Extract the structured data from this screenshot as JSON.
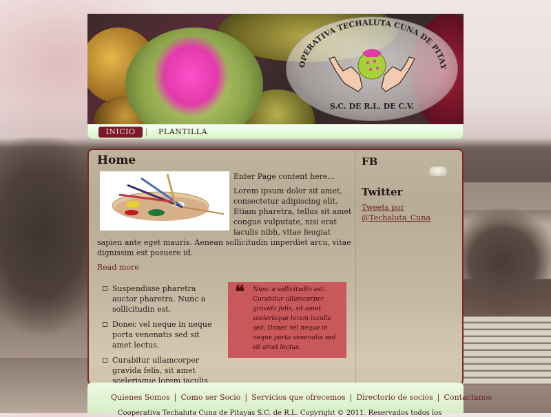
{
  "header": {
    "logo": {
      "arc_top": "COOPERATIVA TECHALUTA CUNA DE PITAYAS",
      "arc_bottom": "S.C. DE R.L. DE C.V."
    }
  },
  "nav": {
    "items": [
      {
        "label": "INICIO",
        "active": true
      },
      {
        "label": "PLANTILLA",
        "active": false
      }
    ]
  },
  "main": {
    "title": "Home",
    "intro": "Enter Page content here...",
    "body": "Lorem ipsum dolor sit amet, consectetur adipiscing elit. Etiam pharetra, tellus sit amet congue vulputate, nisi erat iaculis nibh, vitae feugiat sapien ante eget mauris. Aenean sollicitudin imperdiet arcu, vitae dignissim est posuere id.",
    "read_more": "Read more",
    "bullets": [
      "Suspendisse pharetra auctor pharetra. Nunc a sollicitudin est.",
      "Donec vel neque in neque porta venenatis sed sit amet lectus.",
      "Curabitur ullamcorper gravida felis, sit amet scelerisque lorem iaculis sed."
    ],
    "quote": "Nunc a sollicitudin est. Curabitur ullamcorper gravida felis, sit amet scelerisque lorem iaculis sed. Donec vel neque in neque porta venenatis sed sit amet lectus."
  },
  "sidebar": {
    "fb_title": "FB",
    "twitter_title": "Twitter",
    "tweets_link": "Tweets por @Techaluta_Cuna"
  },
  "footer": {
    "links": [
      "Quienes Somos",
      "Como ser Socio",
      "Servicios que ofrecemos",
      "Directorio de socios",
      "Contactanos"
    ],
    "copyright": "Cooperativa Techaluta Cuna de Pitayas S.C. de R.L. Copyright © 2011. Reservados todos los"
  },
  "colors": {
    "accent": "#7a1a2c",
    "nav_bg": "#d9f4c8",
    "quote_bg": "#c8585a",
    "link": "#6a1d1d"
  },
  "icons": {
    "quote": "quote-icon",
    "bullet": "square-bullet-icon"
  }
}
